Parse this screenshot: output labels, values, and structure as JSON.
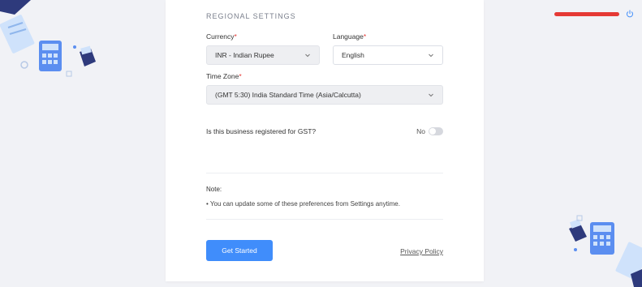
{
  "section_title": "REGIONAL SETTINGS",
  "currency": {
    "label": "Currency",
    "required_mark": "*",
    "value": "INR - Indian Rupee"
  },
  "language": {
    "label": "Language",
    "required_mark": "*",
    "value": "English"
  },
  "timezone": {
    "label": "Time Zone",
    "required_mark": "*",
    "value": "(GMT 5:30) India Standard Time (Asia/Calcutta)"
  },
  "gst": {
    "question": "Is this business registered for GST?",
    "toggle_label": "No",
    "enabled": false
  },
  "note": {
    "title": "Note:",
    "items": [
      "You can update some of these preferences from Settings anytime."
    ]
  },
  "actions": {
    "get_started": "Get Started",
    "privacy_policy": "Privacy Policy"
  },
  "colors": {
    "primary": "#408dfb",
    "required": "#e53935",
    "background": "#f1f2f6"
  },
  "icons": [
    "calculator-illustration",
    "power-icon",
    "chevron-down-icon"
  ]
}
